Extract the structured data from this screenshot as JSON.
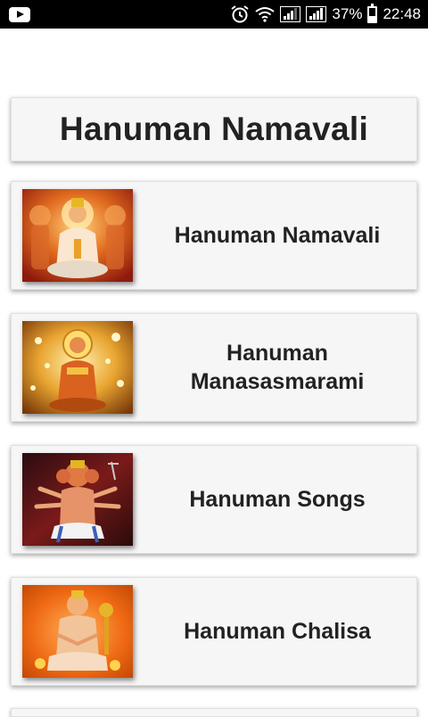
{
  "status_bar": {
    "battery": "37%",
    "time": "22:48"
  },
  "header": {
    "title": "Hanuman Namavali"
  },
  "items": [
    {
      "label": "Hanuman Namavali",
      "thumb_icon": "hanuman-image-icon"
    },
    {
      "label": "Hanuman Manasasmarami",
      "thumb_icon": "hanuman-image-icon"
    },
    {
      "label": "Hanuman Songs",
      "thumb_icon": "hanuman-image-icon"
    },
    {
      "label": "Hanuman Chalisa",
      "thumb_icon": "hanuman-image-icon"
    }
  ]
}
